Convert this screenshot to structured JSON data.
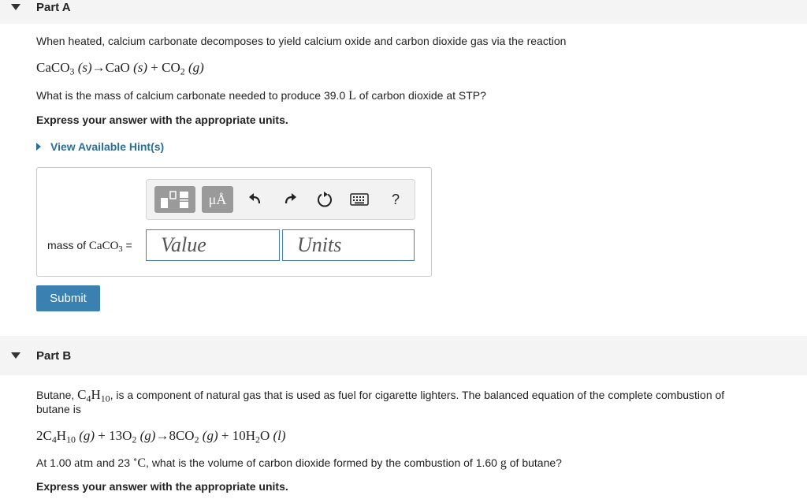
{
  "partA": {
    "title": "Part A",
    "intro": "When heated, calcium carbonate decomposes to yield calcium oxide and carbon dioxide gas via the reaction",
    "question_pre": "What is the mass of calcium carbonate needed to produce 39.0 ",
    "question_unit": "L",
    "question_post": " of carbon dioxide at STP?",
    "instruction": "Express your answer with the appropriate units.",
    "hint_label": "View Available Hint(s)",
    "answer_label": "mass of ",
    "answer_label_eq": " =",
    "value_placeholder": "Value",
    "units_placeholder": "Units",
    "unit_button_label": "μÅ",
    "help_label": "?",
    "submit_label": "Submit"
  },
  "partB": {
    "title": "Part B",
    "text_pre": "Butane, ",
    "text_post": ", is a component of natural gas that is used as fuel for cigarette lighters. The balanced equation of the complete combustion of",
    "text_line2": "butane is",
    "q_at": "At 1.00 ",
    "q_atm": "atm",
    "q_and": " and 23 ",
    "q_mid": ", what is the volume of carbon dioxide formed by the combustion of 1.60 ",
    "q_g": "g",
    "q_end": " of butane?",
    "instruction": "Express your answer with the appropriate units."
  }
}
